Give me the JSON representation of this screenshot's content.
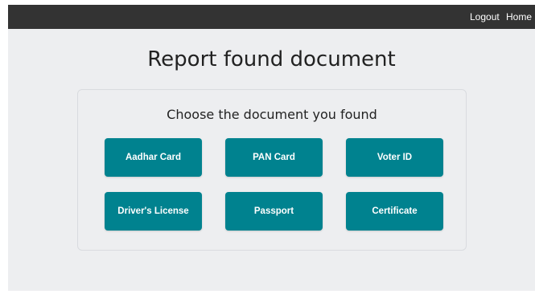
{
  "nav": {
    "logout_label": "Logout",
    "home_label": "Home"
  },
  "page": {
    "title": "Report found document"
  },
  "card": {
    "title": "Choose the document you found",
    "documents": [
      {
        "label": "Aadhar Card"
      },
      {
        "label": "PAN Card"
      },
      {
        "label": "Voter ID"
      },
      {
        "label": "Driver's License"
      },
      {
        "label": "Passport"
      },
      {
        "label": "Certificate"
      }
    ]
  },
  "colors": {
    "topbar": "#333333",
    "page_background": "#edeef0",
    "button": "#00828f",
    "button_text": "#ffffff"
  }
}
